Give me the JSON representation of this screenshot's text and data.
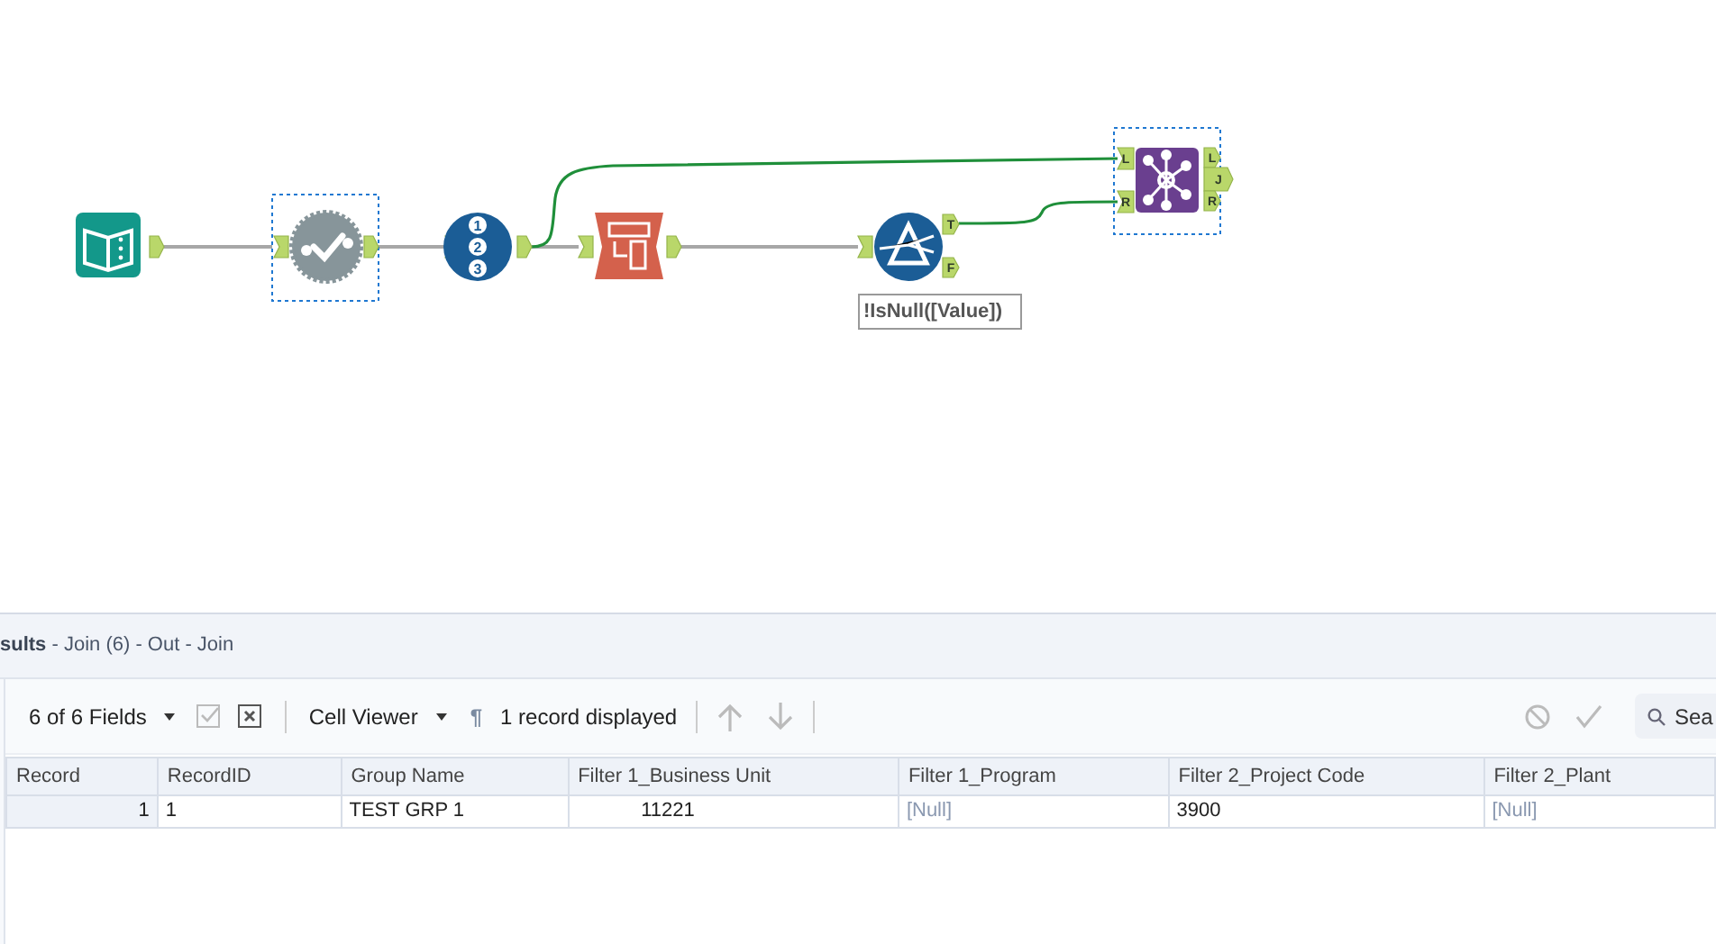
{
  "canvas": {
    "tools": [
      {
        "kind": "input",
        "selected": false
      },
      {
        "kind": "select",
        "selected": true
      },
      {
        "kind": "record_id",
        "selected": false,
        "numbers": [
          "1",
          "2",
          "3"
        ]
      },
      {
        "kind": "transpose",
        "selected": false
      },
      {
        "kind": "filter",
        "selected": false,
        "output_labels": [
          "T",
          "F"
        ],
        "annotation": "!IsNull([Value])"
      },
      {
        "kind": "join",
        "selected": true,
        "input_labels": [
          "L",
          "R"
        ],
        "output_labels": [
          "L",
          "J",
          "R"
        ]
      }
    ]
  },
  "results": {
    "title": "sults",
    "path": " - Join (6) - Out - Join",
    "toolbar": {
      "fields": "6 of 6 Fields",
      "viewer": "Cell Viewer",
      "pilcrow": "¶",
      "records": "1 record displayed",
      "search_placeholder": "Sea"
    },
    "table": {
      "columns": [
        "Record",
        "RecordID",
        "Group Name",
        "Filter 1_Business Unit",
        "Filter 1_Program",
        "Filter 2_Project Code",
        "Filter 2_Plant"
      ],
      "rows": [
        [
          "1",
          "1",
          "TEST GRP 1",
          "11221",
          "[Null]",
          "3900",
          "[Null]"
        ]
      ]
    }
  }
}
